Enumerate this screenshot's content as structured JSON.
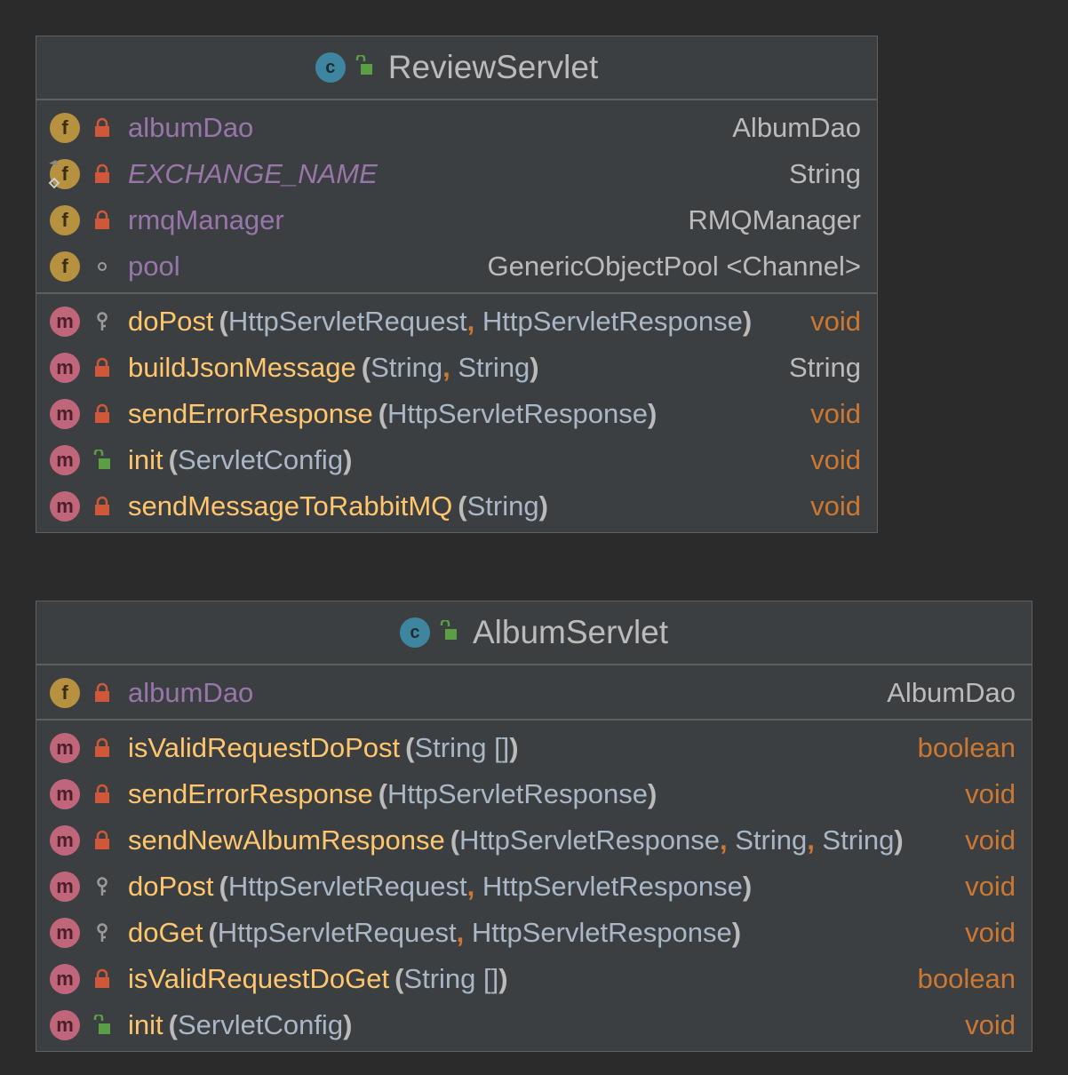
{
  "classes": [
    {
      "name": "ReviewServlet",
      "fields": [
        {
          "name": "albumDao",
          "type": "AlbumDao",
          "visibility": "private",
          "italic": false,
          "static_final": false
        },
        {
          "name": "EXCHANGE_NAME",
          "type": "String",
          "visibility": "private",
          "italic": true,
          "static_final": true
        },
        {
          "name": "rmqManager",
          "type": "RMQManager",
          "visibility": "private",
          "italic": false,
          "static_final": false
        },
        {
          "name": "pool",
          "type": "GenericObjectPool <Channel>",
          "visibility": "package",
          "italic": false,
          "static_final": false
        }
      ],
      "methods": [
        {
          "name": "doPost",
          "params": [
            "HttpServletRequest",
            "HttpServletResponse"
          ],
          "ret": "void",
          "ret_kind": "keyword",
          "visibility": "protected"
        },
        {
          "name": "buildJsonMessage",
          "params": [
            "String",
            "String"
          ],
          "ret": "String",
          "ret_kind": "type",
          "visibility": "private"
        },
        {
          "name": "sendErrorResponse",
          "params": [
            "HttpServletResponse"
          ],
          "ret": "void",
          "ret_kind": "keyword",
          "visibility": "private"
        },
        {
          "name": "init",
          "params": [
            "ServletConfig"
          ],
          "ret": "void",
          "ret_kind": "keyword",
          "visibility": "public"
        },
        {
          "name": "sendMessageToRabbitMQ",
          "params": [
            "String"
          ],
          "ret": "void",
          "ret_kind": "keyword",
          "visibility": "private"
        }
      ]
    },
    {
      "name": "AlbumServlet",
      "fields": [
        {
          "name": "albumDao",
          "type": "AlbumDao",
          "visibility": "private",
          "italic": false,
          "static_final": false
        }
      ],
      "methods": [
        {
          "name": "isValidRequestDoPost",
          "params": [
            "String []"
          ],
          "ret": "boolean",
          "ret_kind": "keyword",
          "visibility": "private"
        },
        {
          "name": "sendErrorResponse",
          "params": [
            "HttpServletResponse"
          ],
          "ret": "void",
          "ret_kind": "keyword",
          "visibility": "private"
        },
        {
          "name": "sendNewAlbumResponse",
          "params": [
            "HttpServletResponse",
            "String",
            "String"
          ],
          "ret": "void",
          "ret_kind": "keyword",
          "visibility": "private"
        },
        {
          "name": "doPost",
          "params": [
            "HttpServletRequest",
            "HttpServletResponse"
          ],
          "ret": "void",
          "ret_kind": "keyword",
          "visibility": "protected"
        },
        {
          "name": "doGet",
          "params": [
            "HttpServletRequest",
            "HttpServletResponse"
          ],
          "ret": "void",
          "ret_kind": "keyword",
          "visibility": "protected"
        },
        {
          "name": "isValidRequestDoGet",
          "params": [
            "String []"
          ],
          "ret": "boolean",
          "ret_kind": "keyword",
          "visibility": "private"
        },
        {
          "name": "init",
          "params": [
            "ServletConfig"
          ],
          "ret": "void",
          "ret_kind": "keyword",
          "visibility": "public"
        }
      ]
    }
  ],
  "icons": {
    "class": "class-icon",
    "field": "field-icon",
    "method": "method-icon",
    "private": "lock-icon",
    "public": "unlocked-icon",
    "protected": "key-icon",
    "package": "dot-icon"
  },
  "colors": {
    "background": "#2b2b2b",
    "panel": "#3c3f41",
    "field_name": "#9876aa",
    "method_name": "#ffc66d",
    "keyword": "#cc7832",
    "text": "#bbbbbb"
  }
}
